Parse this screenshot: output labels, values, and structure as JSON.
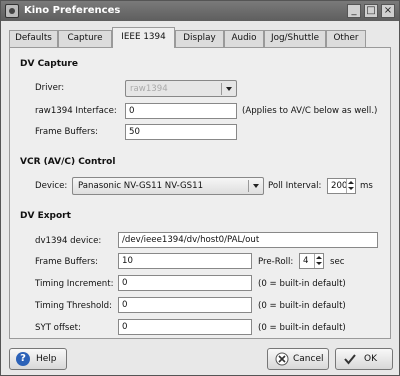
{
  "window": {
    "title": "Kino Preferences",
    "buttons": {
      "minimize": "_",
      "maximize": "□",
      "close": "×"
    }
  },
  "tabs": [
    {
      "label": "Defaults",
      "active": false
    },
    {
      "label": "Capture",
      "active": false
    },
    {
      "label": "IEEE 1394",
      "active": true
    },
    {
      "label": "Display",
      "active": false
    },
    {
      "label": "Audio",
      "active": false
    },
    {
      "label": "Jog/Shuttle",
      "active": false
    },
    {
      "label": "Other",
      "active": false
    }
  ],
  "dv_capture": {
    "heading": "DV Capture",
    "driver_label": "Driver:",
    "driver_value": "raw1394",
    "interface_label": "raw1394 Interface:",
    "interface_value": "0",
    "interface_hint": "(Applies to AV/C below as well.)",
    "frame_buffers_label": "Frame Buffers:",
    "frame_buffers_value": "50"
  },
  "vcr": {
    "heading": "VCR (AV/C) Control",
    "device_label": "Device:",
    "device_value": "Panasonic NV-GS11 NV-GS11",
    "poll_label": "Poll Interval:",
    "poll_value": "200",
    "poll_unit": "ms"
  },
  "dv_export": {
    "heading": "DV Export",
    "device_label": "dv1394 device:",
    "device_value": "/dev/ieee1394/dv/host0/PAL/out",
    "frame_buffers_label": "Frame Buffers:",
    "frame_buffers_value": "10",
    "preroll_label": "Pre-Roll:",
    "preroll_value": "4",
    "preroll_unit": "sec",
    "timing_increment_label": "Timing Increment:",
    "timing_increment_value": "0",
    "timing_increment_hint": "(0 = built-in default)",
    "timing_threshold_label": "Timing Threshold:",
    "timing_threshold_value": "0",
    "timing_threshold_hint": "(0 = built-in default)",
    "syt_offset_label": "SYT offset:",
    "syt_offset_value": "0",
    "syt_offset_hint": "(0 = built-in default)"
  },
  "footer": {
    "help_label": "Help",
    "cancel_label": "Cancel",
    "ok_label": "OK"
  }
}
